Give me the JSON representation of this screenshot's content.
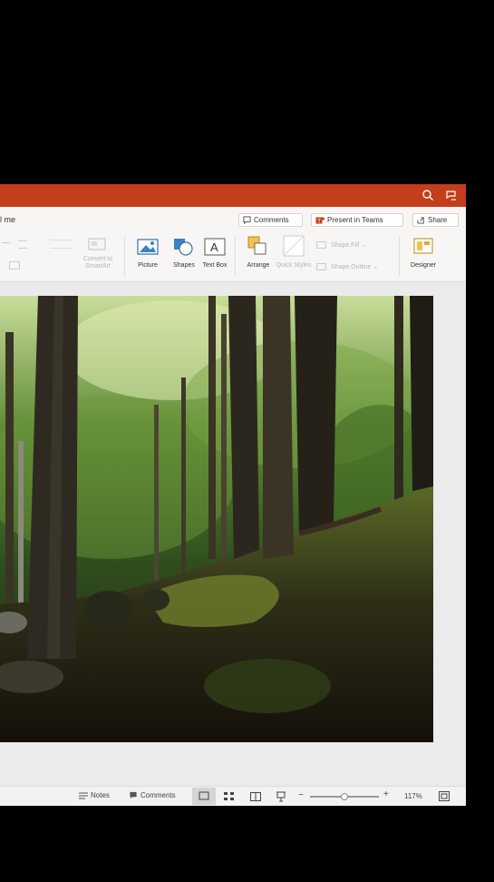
{
  "ribbon": {
    "tell_me": "l me",
    "comments_btn": "Comments",
    "present_btn": "Present in Teams",
    "share_btn": "Share",
    "convert_smartart": "Convert to SmartArt",
    "picture": "Picture",
    "shapes": "Shapes",
    "text_box": "Text Box",
    "arrange": "Arrange",
    "quick_styles": "Quick Styles",
    "shape_fill": "Shape Fill",
    "shape_outline": "Shape Outline",
    "designer": "Designer"
  },
  "status": {
    "notes": "Notes",
    "comments": "Comments",
    "zoom": "117%",
    "zoom_level": 0.5
  },
  "colors": {
    "titlebar": "#c43e1c",
    "accent": "#2b7cd3"
  },
  "icons": [
    "search-icon",
    "feedback-icon",
    "comment-icon",
    "teams-icon",
    "share-icon",
    "picture-icon",
    "shapes-icon",
    "textbox-icon",
    "arrange-icon",
    "quick-styles-icon",
    "designer-icon",
    "notes-icon",
    "normal-view-icon",
    "grid-view-icon",
    "reading-view-icon",
    "slideshow-icon",
    "zoom-out-icon",
    "zoom-in-icon",
    "fit-slide-icon"
  ]
}
